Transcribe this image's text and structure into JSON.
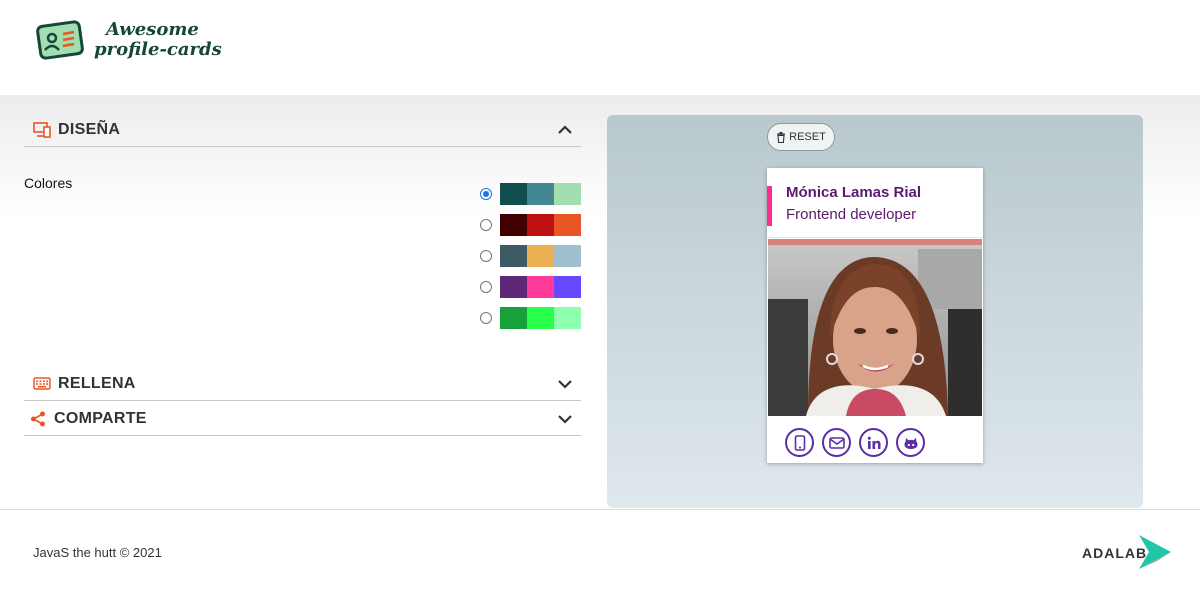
{
  "header": {
    "logo_line1": "Awesome",
    "logo_line2": "profile-cards",
    "logo_icon": "id-card-icon"
  },
  "sections": {
    "design": {
      "title": "DISEÑA",
      "icon": "monitor-icon",
      "expanded": true
    },
    "fill": {
      "title": "RELLENA",
      "icon": "keyboard-icon",
      "expanded": false
    },
    "share": {
      "title": "COMPARTE",
      "icon": "share-icon",
      "expanded": false
    }
  },
  "colors": {
    "label": "Colores",
    "selected": 0,
    "palettes": [
      [
        "#114e4e",
        "#438792",
        "#a2deaf"
      ],
      [
        "#420101",
        "#bd1010",
        "#e95626"
      ],
      [
        "#3e5b65",
        "#eab052",
        "#a0c0cf"
      ],
      [
        "#5d2877",
        "#ff3a9b",
        "#6548ff"
      ],
      [
        "#18a03d",
        "#28ff48",
        "#8fffb0"
      ]
    ]
  },
  "preview": {
    "reset_label": "RESET",
    "card": {
      "name": "Mónica Lamas Rial",
      "job": "Frontend developer",
      "accent": "#ff2c8d",
      "text_color": "#5b1a6e",
      "icon_color": "#5b2da8",
      "social_icons": [
        "phone-icon",
        "email-icon",
        "linkedin-icon",
        "github-icon"
      ]
    }
  },
  "footer": {
    "copyright": "JavaS the hutt © 2021",
    "brand": "ADALAB"
  }
}
